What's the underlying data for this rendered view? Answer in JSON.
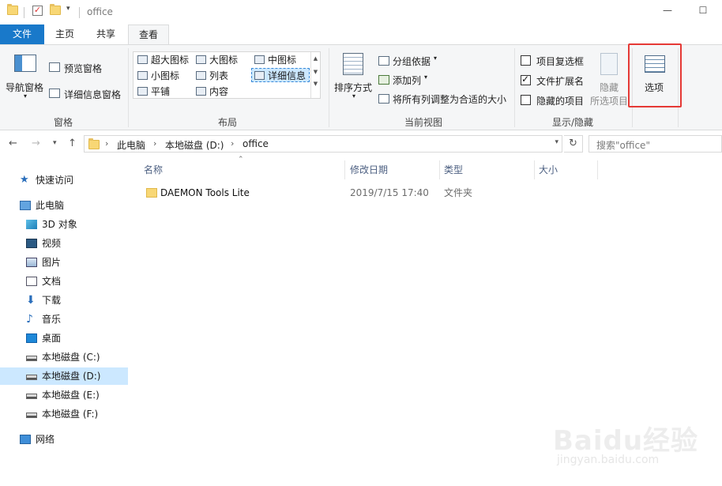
{
  "window": {
    "title": "office",
    "minimize_icon": "minimize-icon",
    "maximize_icon": "maximize-icon"
  },
  "quick_access": {
    "icons": [
      "folder-icon",
      "properties-check-icon",
      "new-folder-icon",
      "customize-toolbar-icon"
    ]
  },
  "tabs": [
    {
      "label": "文件"
    },
    {
      "label": "主页"
    },
    {
      "label": "共享"
    },
    {
      "label": "查看"
    }
  ],
  "ribbon": {
    "panes": {
      "label": "窗格",
      "navigation_pane": "导航窗格",
      "preview_pane": "预览窗格",
      "details_pane": "详细信息窗格"
    },
    "layout": {
      "label": "布局",
      "items": [
        {
          "label": "超大图标"
        },
        {
          "label": "大图标"
        },
        {
          "label": "中图标"
        },
        {
          "label": "小图标"
        },
        {
          "label": "列表"
        },
        {
          "label": "详细信息"
        },
        {
          "label": "平铺"
        },
        {
          "label": "内容"
        }
      ],
      "selected": "详细信息"
    },
    "current_view": {
      "label": "当前视图",
      "sort_by": "排序方式",
      "group_by": "分组依据",
      "add_columns": "添加列",
      "size_all_columns": "将所有列调整为合适的大小"
    },
    "show_hide": {
      "label": "显示/隐藏",
      "item_checkboxes": {
        "label": "项目复选框",
        "checked": false
      },
      "file_extensions": {
        "label": "文件扩展名",
        "checked": true
      },
      "hidden_items": {
        "label": "隐藏的项目",
        "checked": false
      },
      "hide_selected_line1": "隐藏",
      "hide_selected_line2": "所选项目"
    },
    "options": {
      "label": "选项"
    },
    "highlight_color": "#e53935"
  },
  "address_bar": {
    "crumbs": [
      "此电脑",
      "本地磁盘 (D:)",
      "office"
    ],
    "search_placeholder": "搜索\"office\""
  },
  "nav_pane": {
    "items": [
      {
        "label": "快速访问",
        "icon": "quick-access-star-icon"
      },
      {
        "label": "此电脑",
        "icon": "this-pc-icon"
      },
      {
        "label": "3D 对象",
        "icon": "3d-objects-icon"
      },
      {
        "label": "视频",
        "icon": "videos-icon"
      },
      {
        "label": "图片",
        "icon": "pictures-icon"
      },
      {
        "label": "文档",
        "icon": "documents-icon"
      },
      {
        "label": "下载",
        "icon": "downloads-icon"
      },
      {
        "label": "音乐",
        "icon": "music-icon"
      },
      {
        "label": "桌面",
        "icon": "desktop-icon"
      },
      {
        "label": "本地磁盘 (C:)",
        "icon": "drive-c-icon"
      },
      {
        "label": "本地磁盘 (D:)",
        "icon": "drive-d-icon",
        "selected": true
      },
      {
        "label": "本地磁盘 (E:)",
        "icon": "drive-e-icon"
      },
      {
        "label": "本地磁盘 (F:)",
        "icon": "drive-f-icon"
      },
      {
        "label": "网络",
        "icon": "network-icon"
      }
    ]
  },
  "file_list": {
    "columns": [
      "名称",
      "修改日期",
      "类型",
      "大小"
    ],
    "rows": [
      {
        "name": "DAEMON Tools Lite",
        "date": "2019/7/15 17:40",
        "type": "文件夹",
        "size": ""
      }
    ]
  },
  "watermark": {
    "line1": "Baidu经验",
    "line2": "jingyan.baidu.com"
  }
}
